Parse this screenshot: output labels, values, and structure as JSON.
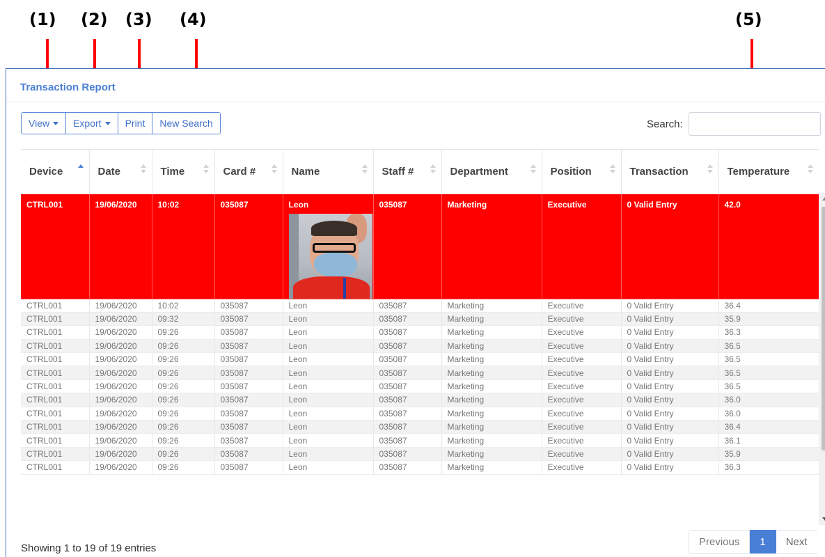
{
  "annotations": [
    {
      "label": "(1)"
    },
    {
      "label": "(2)"
    },
    {
      "label": "(3)"
    },
    {
      "label": "(4)"
    },
    {
      "label": "(5)"
    }
  ],
  "panel": {
    "title": "Transaction Report"
  },
  "toolbar": {
    "view_label": "View",
    "export_label": "Export",
    "print_label": "Print",
    "new_search_label": "New Search"
  },
  "search": {
    "label": "Search:",
    "value": "",
    "placeholder": ""
  },
  "table": {
    "headers": [
      "Device",
      "Date",
      "Time",
      "Card #",
      "Name",
      "Staff #",
      "Department",
      "Position",
      "Transaction",
      "Temperature"
    ],
    "sorted_column": "Device",
    "sort_direction": "ascending",
    "highlight_color": "#ff0000",
    "rows": [
      {
        "device": "CTRL001",
        "date": "19/06/2020",
        "time": "10:02",
        "card": "035087",
        "name": "Leon",
        "staff": "035087",
        "department": "Marketing",
        "position": "Executive",
        "transaction": "0 Valid Entry",
        "temperature": "42.0",
        "highlight": true,
        "photo": "person-photo"
      },
      {
        "device": "CTRL001",
        "date": "19/06/2020",
        "time": "10:02",
        "card": "035087",
        "name": "Leon",
        "staff": "035087",
        "department": "Marketing",
        "position": "Executive",
        "transaction": "0 Valid Entry",
        "temperature": "36.4"
      },
      {
        "device": "CTRL001",
        "date": "19/06/2020",
        "time": "09:32",
        "card": "035087",
        "name": "Leon",
        "staff": "035087",
        "department": "Marketing",
        "position": "Executive",
        "transaction": "0 Valid Entry",
        "temperature": "35.9"
      },
      {
        "device": "CTRL001",
        "date": "19/06/2020",
        "time": "09:26",
        "card": "035087",
        "name": "Leon",
        "staff": "035087",
        "department": "Marketing",
        "position": "Executive",
        "transaction": "0 Valid Entry",
        "temperature": "36.3"
      },
      {
        "device": "CTRL001",
        "date": "19/06/2020",
        "time": "09:26",
        "card": "035087",
        "name": "Leon",
        "staff": "035087",
        "department": "Marketing",
        "position": "Executive",
        "transaction": "0 Valid Entry",
        "temperature": "36.5"
      },
      {
        "device": "CTRL001",
        "date": "19/06/2020",
        "time": "09:26",
        "card": "035087",
        "name": "Leon",
        "staff": "035087",
        "department": "Marketing",
        "position": "Executive",
        "transaction": "0 Valid Entry",
        "temperature": "36.5"
      },
      {
        "device": "CTRL001",
        "date": "19/06/2020",
        "time": "09:26",
        "card": "035087",
        "name": "Leon",
        "staff": "035087",
        "department": "Marketing",
        "position": "Executive",
        "transaction": "0 Valid Entry",
        "temperature": "36.5"
      },
      {
        "device": "CTRL001",
        "date": "19/06/2020",
        "time": "09:26",
        "card": "035087",
        "name": "Leon",
        "staff": "035087",
        "department": "Marketing",
        "position": "Executive",
        "transaction": "0 Valid Entry",
        "temperature": "36.5"
      },
      {
        "device": "CTRL001",
        "date": "19/06/2020",
        "time": "09:26",
        "card": "035087",
        "name": "Leon",
        "staff": "035087",
        "department": "Marketing",
        "position": "Executive",
        "transaction": "0 Valid Entry",
        "temperature": "36.0"
      },
      {
        "device": "CTRL001",
        "date": "19/06/2020",
        "time": "09:26",
        "card": "035087",
        "name": "Leon",
        "staff": "035087",
        "department": "Marketing",
        "position": "Executive",
        "transaction": "0 Valid Entry",
        "temperature": "36.0"
      },
      {
        "device": "CTRL001",
        "date": "19/06/2020",
        "time": "09:26",
        "card": "035087",
        "name": "Leon",
        "staff": "035087",
        "department": "Marketing",
        "position": "Executive",
        "transaction": "0 Valid Entry",
        "temperature": "36.4"
      },
      {
        "device": "CTRL001",
        "date": "19/06/2020",
        "time": "09:26",
        "card": "035087",
        "name": "Leon",
        "staff": "035087",
        "department": "Marketing",
        "position": "Executive",
        "transaction": "0 Valid Entry",
        "temperature": "36.1"
      },
      {
        "device": "CTRL001",
        "date": "19/06/2020",
        "time": "09:26",
        "card": "035087",
        "name": "Leon",
        "staff": "035087",
        "department": "Marketing",
        "position": "Executive",
        "transaction": "0 Valid Entry",
        "temperature": "35.9"
      },
      {
        "device": "CTRL001",
        "date": "19/06/2020",
        "time": "09:26",
        "card": "035087",
        "name": "Leon",
        "staff": "035087",
        "department": "Marketing",
        "position": "Executive",
        "transaction": "0 Valid Entry",
        "temperature": "36.3"
      }
    ]
  },
  "footer": {
    "info": "Showing 1 to 19 of 19 entries",
    "previous_label": "Previous",
    "current_page": "1",
    "next_label": "Next"
  }
}
